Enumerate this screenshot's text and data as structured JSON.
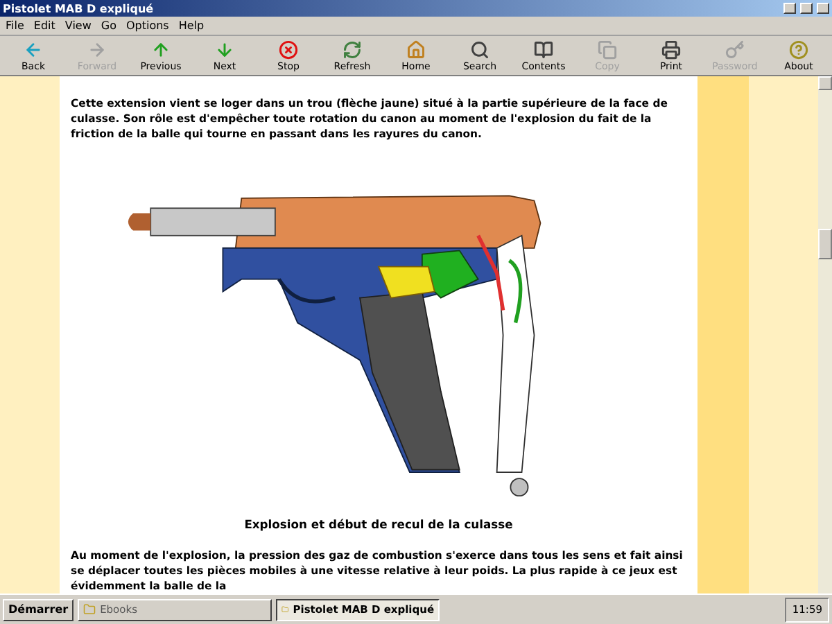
{
  "window": {
    "title": "Pistolet MAB D expliqué"
  },
  "menu": [
    "File",
    "Edit",
    "View",
    "Go",
    "Options",
    "Help"
  ],
  "toolbar": [
    {
      "label": "Back",
      "disabled": false
    },
    {
      "label": "Forward",
      "disabled": true
    },
    {
      "label": "Previous",
      "disabled": false
    },
    {
      "label": "Next",
      "disabled": false
    },
    {
      "label": "Stop",
      "disabled": false
    },
    {
      "label": "Refresh",
      "disabled": false
    },
    {
      "label": "Home",
      "disabled": false
    },
    {
      "label": "Search",
      "disabled": false
    },
    {
      "label": "Contents",
      "disabled": false
    },
    {
      "label": "Copy",
      "disabled": true
    },
    {
      "label": "Print",
      "disabled": false
    },
    {
      "label": "Password",
      "disabled": true
    },
    {
      "label": "About",
      "disabled": false
    }
  ],
  "article": {
    "paragraph": "Cette extension vient se loger dans un trou (flèche jaune) situé à la partie supérieure de la face de culasse. Son rôle est d'empêcher toute rotation du canon au moment de l'explosion du fait de la friction de la balle qui tourne en passant dans les rayures du canon.",
    "caption": "Explosion et début de recul de la culasse",
    "paragraph_2": "Au moment de l'explosion, la pression des gaz de combustion s'exerce dans tous les sens et fait ainsi se déplacer toutes les pièces mobiles à une vitesse relative à leur poids. La plus rapide à ce jeux est évidemment la balle de la"
  },
  "taskbar": {
    "start": "Démarrer",
    "tasks": [
      {
        "label": "Ebooks",
        "selected": false
      },
      {
        "label": "Pistolet MAB D expliqué",
        "selected": true
      }
    ],
    "clock": "11:59"
  }
}
